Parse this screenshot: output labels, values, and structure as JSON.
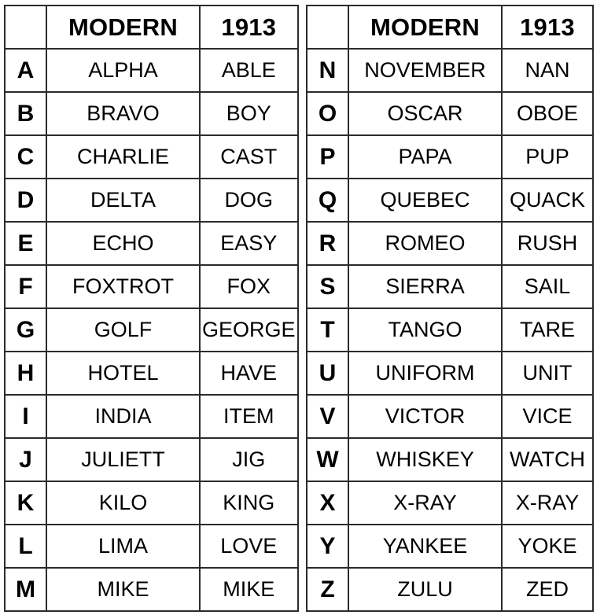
{
  "document": {
    "kind": "comparison-table",
    "column_headers": [
      "",
      "MODERN",
      "1913"
    ]
  },
  "colors": {
    "border": "#2b2b2b",
    "background": "#ffffff",
    "text": "#000000"
  },
  "tables": [
    {
      "id": "left",
      "headers": {
        "blank": "",
        "modern": "MODERN",
        "year": "1913"
      },
      "rows": [
        {
          "letter": "A",
          "modern": "ALPHA",
          "year1913": "ABLE"
        },
        {
          "letter": "B",
          "modern": "BRAVO",
          "year1913": "BOY"
        },
        {
          "letter": "C",
          "modern": "CHARLIE",
          "year1913": "CAST"
        },
        {
          "letter": "D",
          "modern": "DELTA",
          "year1913": "DOG"
        },
        {
          "letter": "E",
          "modern": "ECHO",
          "year1913": "EASY"
        },
        {
          "letter": "F",
          "modern": "FOXTROT",
          "year1913": "FOX"
        },
        {
          "letter": "G",
          "modern": "GOLF",
          "year1913": "GEORGE"
        },
        {
          "letter": "H",
          "modern": "HOTEL",
          "year1913": "HAVE"
        },
        {
          "letter": "I",
          "modern": "INDIA",
          "year1913": "ITEM"
        },
        {
          "letter": "J",
          "modern": "JULIETT",
          "year1913": "JIG"
        },
        {
          "letter": "K",
          "modern": "KILO",
          "year1913": "KING"
        },
        {
          "letter": "L",
          "modern": "LIMA",
          "year1913": "LOVE"
        },
        {
          "letter": "M",
          "modern": "MIKE",
          "year1913": "MIKE"
        }
      ]
    },
    {
      "id": "right",
      "headers": {
        "blank": "",
        "modern": "MODERN",
        "year": "1913"
      },
      "rows": [
        {
          "letter": "N",
          "modern": "NOVEMBER",
          "year1913": "NAN"
        },
        {
          "letter": "O",
          "modern": "OSCAR",
          "year1913": "OBOE"
        },
        {
          "letter": "P",
          "modern": "PAPA",
          "year1913": "PUP"
        },
        {
          "letter": "Q",
          "modern": "QUEBEC",
          "year1913": "QUACK"
        },
        {
          "letter": "R",
          "modern": "ROMEO",
          "year1913": "RUSH"
        },
        {
          "letter": "S",
          "modern": "SIERRA",
          "year1913": "SAIL"
        },
        {
          "letter": "T",
          "modern": "TANGO",
          "year1913": "TARE"
        },
        {
          "letter": "U",
          "modern": "UNIFORM",
          "year1913": "UNIT"
        },
        {
          "letter": "V",
          "modern": "VICTOR",
          "year1913": "VICE"
        },
        {
          "letter": "W",
          "modern": "WHISKEY",
          "year1913": "WATCH"
        },
        {
          "letter": "X",
          "modern": "X-RAY",
          "year1913": "X-RAY"
        },
        {
          "letter": "Y",
          "modern": "YANKEE",
          "year1913": "YOKE"
        },
        {
          "letter": "Z",
          "modern": "ZULU",
          "year1913": "ZED"
        }
      ]
    }
  ]
}
